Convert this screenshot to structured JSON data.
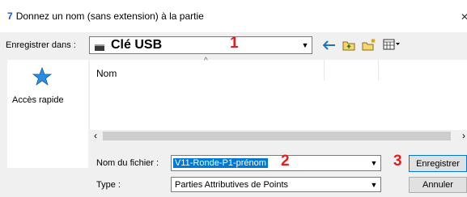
{
  "window": {
    "step_number": "7",
    "title": "Donnez un nom (sans extension) à la partie",
    "close_glyph": "✕"
  },
  "save_in": {
    "label": "Enregistrer dans :",
    "value": "Clé USB",
    "annotation": "1"
  },
  "toolbar": {
    "icons": [
      "back-arrow-icon",
      "up-folder-icon",
      "new-folder-icon",
      "view-menu-icon"
    ]
  },
  "places": {
    "items": [
      {
        "label": "Accès rapide",
        "icon": "star-icon"
      }
    ]
  },
  "file_list": {
    "columns": [
      "Nom"
    ]
  },
  "filename": {
    "label": "Nom du fichier :",
    "value": "V11-Ronde-P1-prénom",
    "annotation": "2"
  },
  "filetype": {
    "label": "Type :",
    "value": "Parties Attributives de Points"
  },
  "buttons": {
    "save": "Enregistrer",
    "save_annotation": "3",
    "cancel": "Annuler"
  },
  "colors": {
    "accent": "#0078d7",
    "annotation_red": "#e02020",
    "step_blue": "#1a56d6"
  }
}
